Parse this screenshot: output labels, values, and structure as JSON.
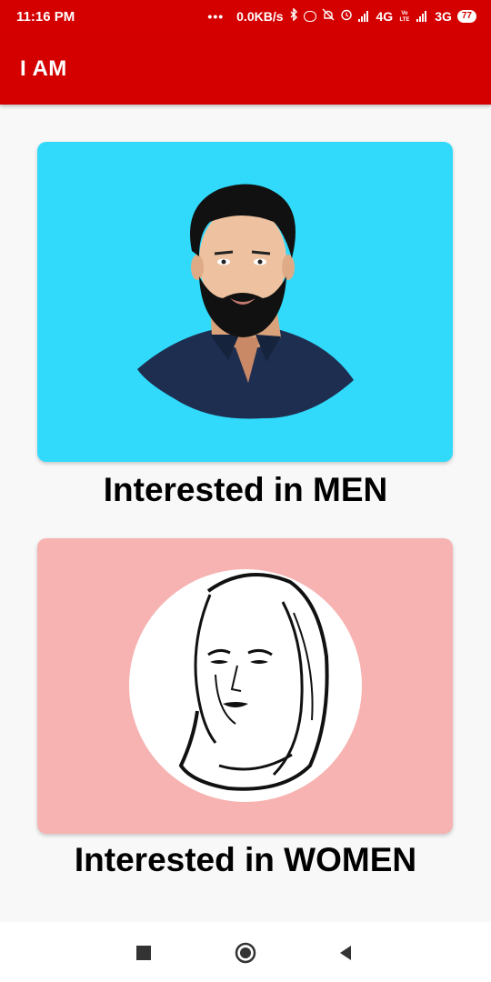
{
  "status_bar": {
    "time": "11:16 PM",
    "dots": "•••",
    "speed": "0.0KB/s",
    "net1": "4G",
    "net2": "3G",
    "battery": "77"
  },
  "app_bar": {
    "title": "I AM"
  },
  "cards": [
    {
      "label": "Interested in MEN",
      "bg": "#31dafb"
    },
    {
      "label": "Interested in WOMEN",
      "bg": "#f6b3b1"
    }
  ],
  "colors": {
    "primary": "#d40000"
  },
  "nav": {
    "icons": [
      "square-recents-icon",
      "circle-home-icon",
      "triangle-back-icon"
    ]
  }
}
